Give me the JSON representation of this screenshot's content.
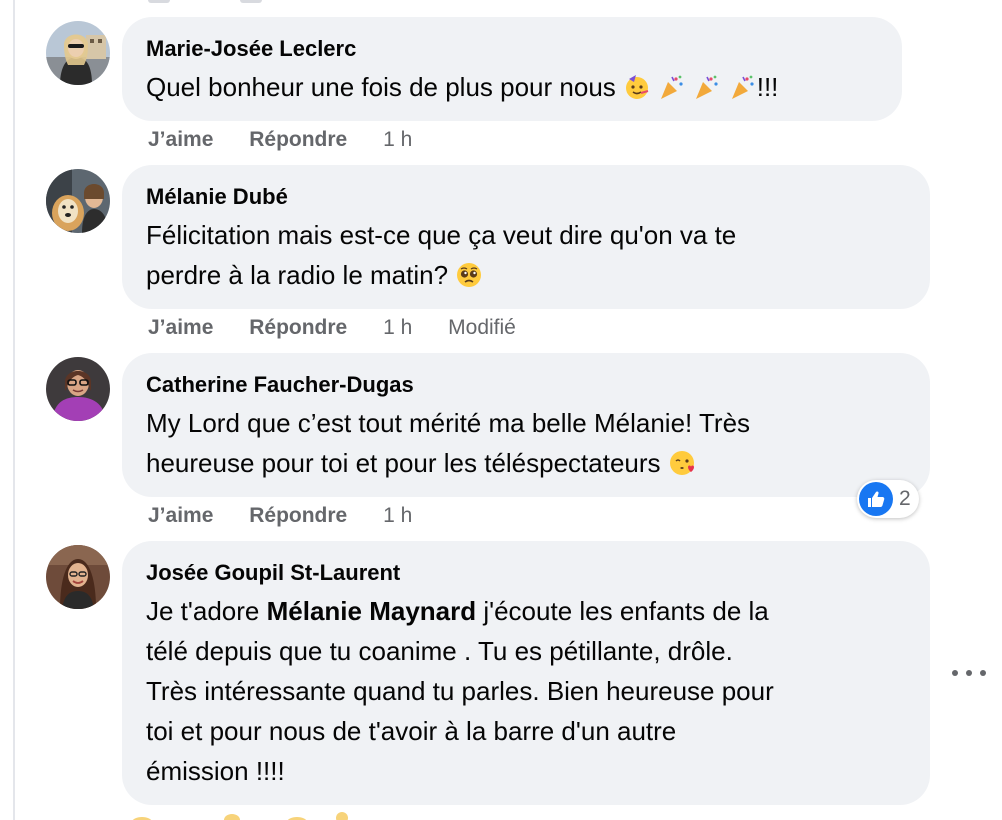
{
  "comments": [
    {
      "author": "Marie-Josée Leclerc",
      "lines": [
        "Quel bonheur une fois de plus pour nous"
      ],
      "trailing_text": "!!!",
      "emojis": [
        "partying-face-emoji",
        "party-popper-emoji",
        "party-popper-emoji",
        "party-popper-emoji"
      ],
      "actions": {
        "like": "J’aime",
        "reply": "Répondre",
        "time": "1 h"
      }
    },
    {
      "author": "Mélanie Dubé",
      "lines": [
        "Félicitation mais est-ce que ça veut dire qu'on va te",
        "perdre à la radio le matin?"
      ],
      "emojis": [
        "pleading-face-emoji"
      ],
      "actions": {
        "like": "J’aime",
        "reply": "Répondre",
        "time": "1 h",
        "edited": "Modifié"
      }
    },
    {
      "author": "Catherine Faucher-Dugas",
      "lines": [
        "My Lord que c’est tout mérité ma belle Mélanie! Très",
        "heureuse pour toi et pour les téléspectateurs"
      ],
      "emojis": [
        "face-blowing-kiss-emoji"
      ],
      "actions": {
        "like": "J’aime",
        "reply": "Répondre",
        "time": "1 h"
      },
      "reactions": {
        "icon": "like-icon",
        "count": "2"
      }
    },
    {
      "author": "Josée Goupil St-Laurent",
      "line1_before": "Je t'adore",
      "mention": "Mélanie Maynard",
      "line1_after": "j'écoute les enfants de la",
      "lines": [
        "télé depuis que tu coanime . Tu es pétillante, drôle.",
        "Très intéressante quand tu parles. Bien heureuse pour",
        "toi et pour nous de t'avoir à la barre d'un autre",
        "émission !!!!"
      ]
    }
  ],
  "colors": {
    "bubble": "#f0f2f5",
    "meta": "#65676b",
    "text": "#050505",
    "like_blue": "#1877f2"
  },
  "icons": {
    "more": "more-options-icon"
  }
}
